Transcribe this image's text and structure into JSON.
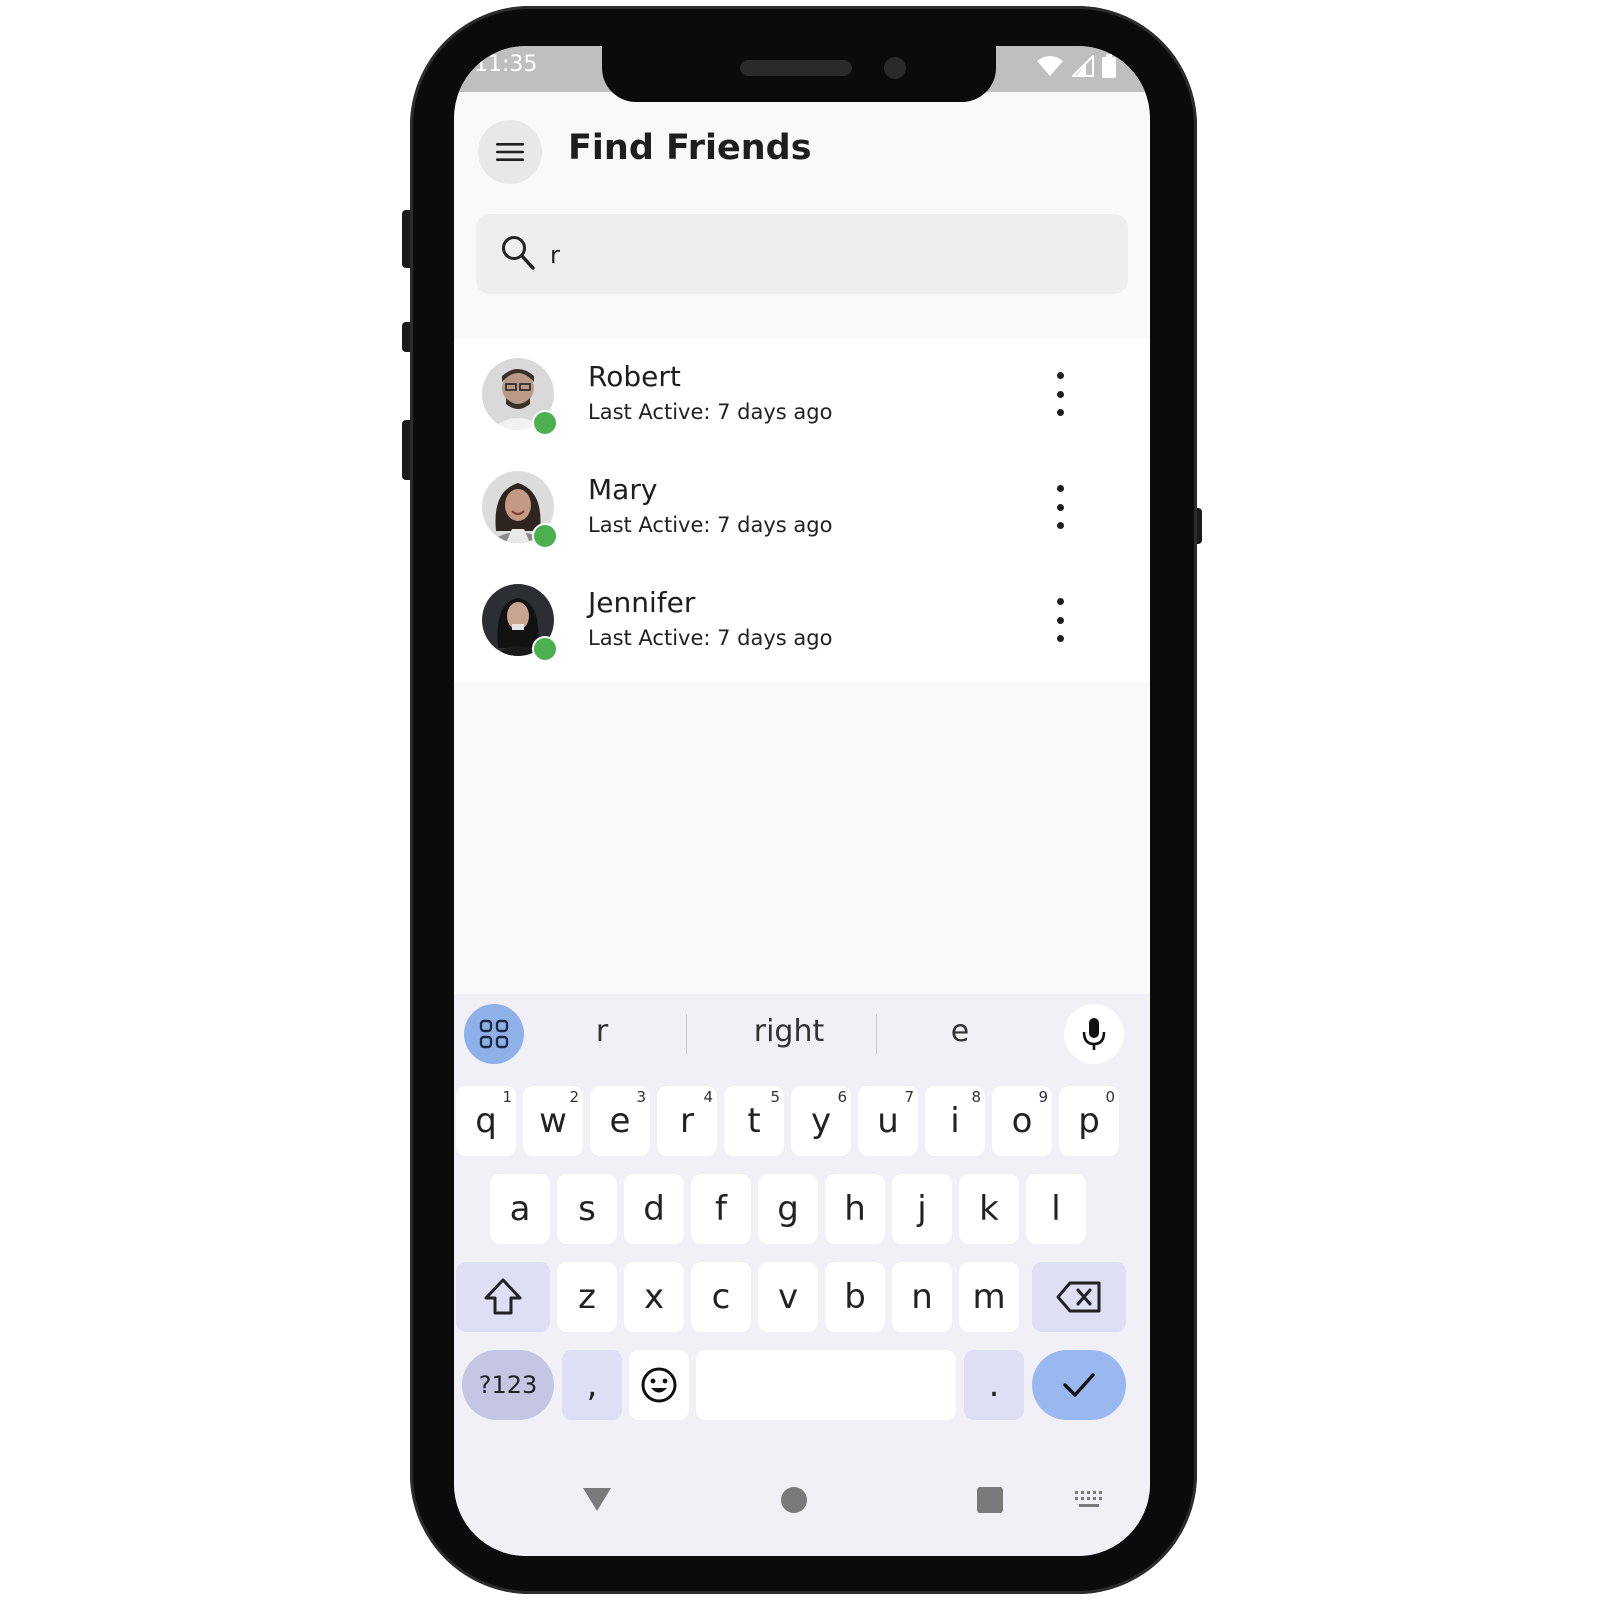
{
  "status_bar": {
    "time": "11:35"
  },
  "header": {
    "title": "Find Friends",
    "menu_icon": "hamburger-menu-icon"
  },
  "search": {
    "value": "r",
    "placeholder": ""
  },
  "friends": [
    {
      "name": "Robert",
      "status": "Last Active: 7 days ago",
      "online": true
    },
    {
      "name": "Mary",
      "status": "Last Active: 7 days ago",
      "online": true
    },
    {
      "name": "Jennifer",
      "status": "Last Active: 7 days ago",
      "online": true
    }
  ],
  "keyboard": {
    "suggestions": [
      "r",
      "right",
      "e"
    ],
    "row1": [
      {
        "key": "q",
        "hint": "1"
      },
      {
        "key": "w",
        "hint": "2"
      },
      {
        "key": "e",
        "hint": "3"
      },
      {
        "key": "r",
        "hint": "4"
      },
      {
        "key": "t",
        "hint": "5"
      },
      {
        "key": "y",
        "hint": "6"
      },
      {
        "key": "u",
        "hint": "7"
      },
      {
        "key": "i",
        "hint": "8"
      },
      {
        "key": "o",
        "hint": "9"
      },
      {
        "key": "p",
        "hint": "0"
      }
    ],
    "row2": [
      "a",
      "s",
      "d",
      "f",
      "g",
      "h",
      "j",
      "k",
      "l"
    ],
    "row3": [
      "z",
      "x",
      "c",
      "v",
      "b",
      "n",
      "m"
    ],
    "symbols_label": "?123",
    "comma": ",",
    "period": "."
  },
  "colors": {
    "online": "#4caf50",
    "keyboard_bg": "#f0f0f6",
    "accent_key": "#99b8f0",
    "special_key": "#dedff5"
  }
}
